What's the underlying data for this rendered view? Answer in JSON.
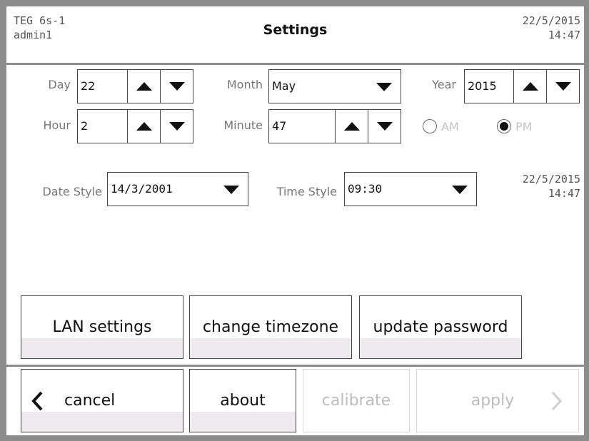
{
  "header": {
    "device_line1": "TEG 6s-1",
    "device_line2": "admin1",
    "title": "Settings",
    "date": "22/5/2015",
    "time": "14:47"
  },
  "date_time": {
    "day": {
      "label": "Day",
      "value": "22"
    },
    "month": {
      "label": "Month",
      "value": "May"
    },
    "year": {
      "label": "Year",
      "value": "2015"
    },
    "hour": {
      "label": "Hour",
      "value": "2"
    },
    "minute": {
      "label": "Minute",
      "value": "47"
    },
    "am_label": "AM",
    "pm_label": "PM",
    "selected_period": "PM"
  },
  "styles": {
    "date_style_label": "Date Style",
    "date_style_value": "14/3/2001",
    "time_style_label": "Time Style",
    "time_style_value": "09:30",
    "preview_date": "22/5/2015",
    "preview_time": "14:47"
  },
  "buttons": {
    "lan": "LAN settings",
    "timezone": "change timezone",
    "password": "update password"
  },
  "footer": {
    "cancel": "cancel",
    "about": "about",
    "calibrate": "calibrate",
    "apply": "apply"
  }
}
